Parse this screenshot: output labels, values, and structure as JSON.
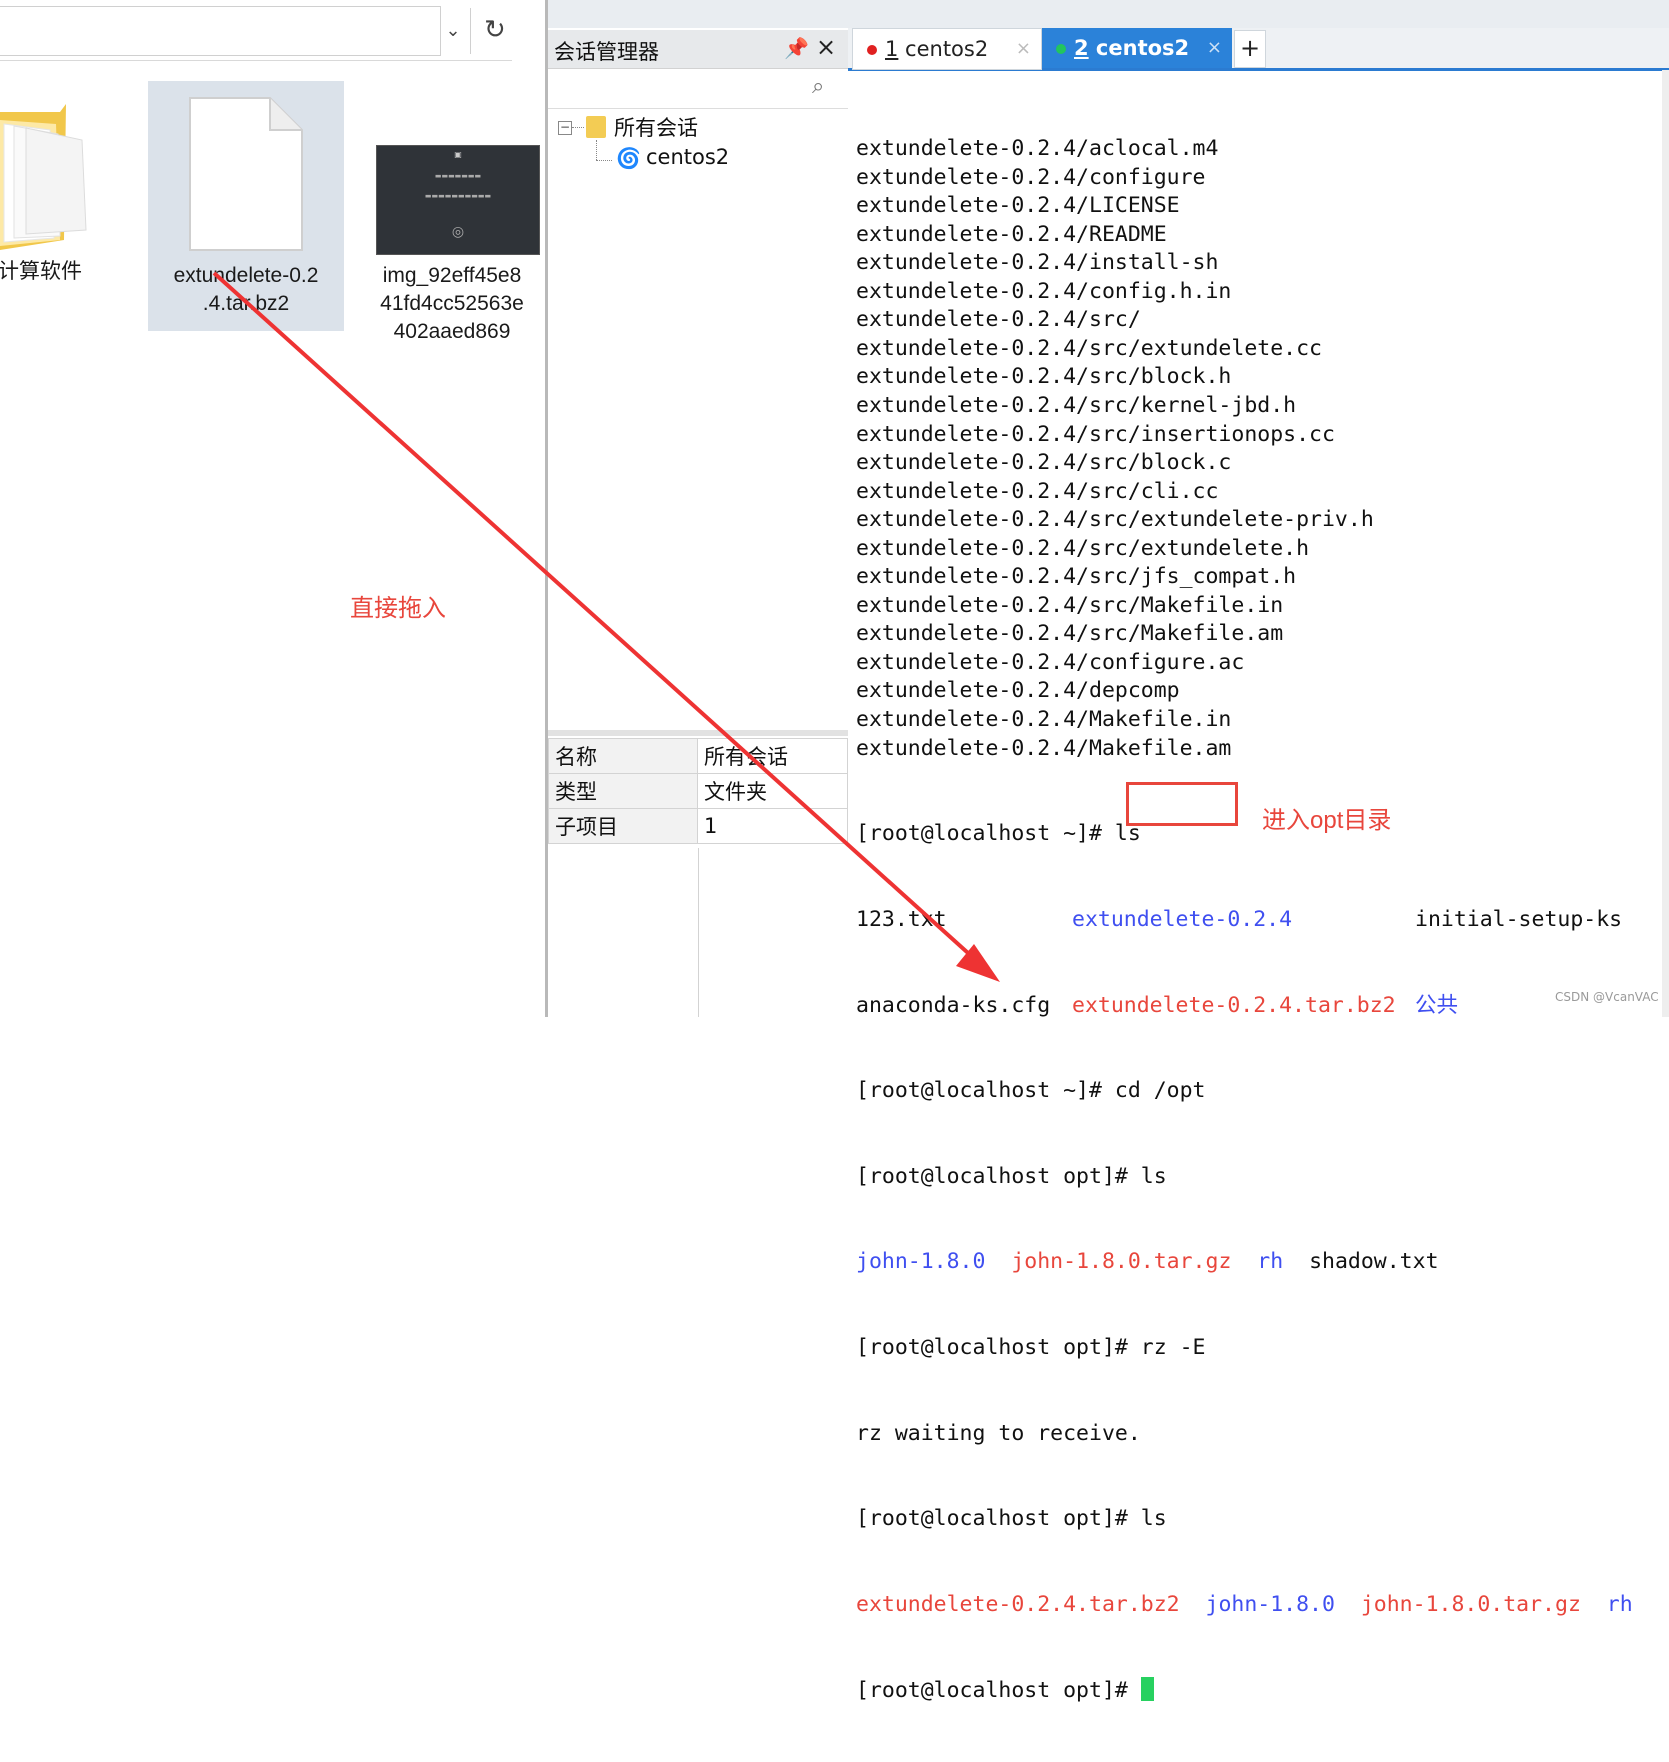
{
  "explorer": {
    "folder_label": "计算软件",
    "file_label_line1": "extundelete-0.2",
    "file_label_line2": ".4.tar.bz2",
    "image_label_line1": "img_92eff45e8",
    "image_label_line2": "41fd4cc52563e",
    "image_label_line3": "402aaed869",
    "refresh_glyph": "↻",
    "chevron_glyph": "⌄"
  },
  "session_manager": {
    "title": "会话管理器",
    "tree_root": "所有会话",
    "tree_child": "centos2",
    "properties": [
      {
        "name": "名称",
        "value": "所有会话"
      },
      {
        "name": "类型",
        "value": "文件夹"
      },
      {
        "name": "子项目",
        "value": "1"
      }
    ]
  },
  "terminal": {
    "tabs": [
      {
        "index": "1",
        "label": " centos2",
        "dot_color": "#e02020",
        "active": false
      },
      {
        "index": "2",
        "label": " centos2",
        "dot_color": "#22c55e",
        "active": true
      }
    ],
    "tar_lines": [
      "extundelete-0.2.4/aclocal.m4",
      "extundelete-0.2.4/configure",
      "extundelete-0.2.4/LICENSE",
      "extundelete-0.2.4/README",
      "extundelete-0.2.4/install-sh",
      "extundelete-0.2.4/config.h.in",
      "extundelete-0.2.4/src/",
      "extundelete-0.2.4/src/extundelete.cc",
      "extundelete-0.2.4/src/block.h",
      "extundelete-0.2.4/src/kernel-jbd.h",
      "extundelete-0.2.4/src/insertionops.cc",
      "extundelete-0.2.4/src/block.c",
      "extundelete-0.2.4/src/cli.cc",
      "extundelete-0.2.4/src/extundelete-priv.h",
      "extundelete-0.2.4/src/extundelete.h",
      "extundelete-0.2.4/src/jfs_compat.h",
      "extundelete-0.2.4/src/Makefile.in",
      "extundelete-0.2.4/src/Makefile.am",
      "extundelete-0.2.4/configure.ac",
      "extundelete-0.2.4/depcomp",
      "extundelete-0.2.4/Makefile.in",
      "extundelete-0.2.4/Makefile.am"
    ],
    "prompt_home": "[root@localhost ~]# ",
    "prompt_opt": "[root@localhost opt]# ",
    "cmd_ls": "ls",
    "cmd_cd": "cd /opt",
    "cmd_rz": "rz -E",
    "ls_home_row1": [
      "123.txt",
      "extundelete-0.2.4",
      "initial-setup-ks"
    ],
    "ls_home_row2": [
      "anaconda-ks.cfg",
      "extundelete-0.2.4.tar.bz2",
      "公共"
    ],
    "ls_opt1": [
      "john-1.8.0",
      "john-1.8.0.tar.gz",
      "rh",
      "shadow.txt"
    ],
    "rz_wait": "rz waiting to receive.",
    "ls_opt2": [
      "extundelete-0.2.4.tar.bz2",
      "john-1.8.0",
      "john-1.8.0.tar.gz",
      "rh"
    ]
  },
  "annotations": {
    "drag_note": "直接拖入",
    "cd_note": "进入opt目录",
    "watermark": "CSDN @VcanVAC"
  }
}
